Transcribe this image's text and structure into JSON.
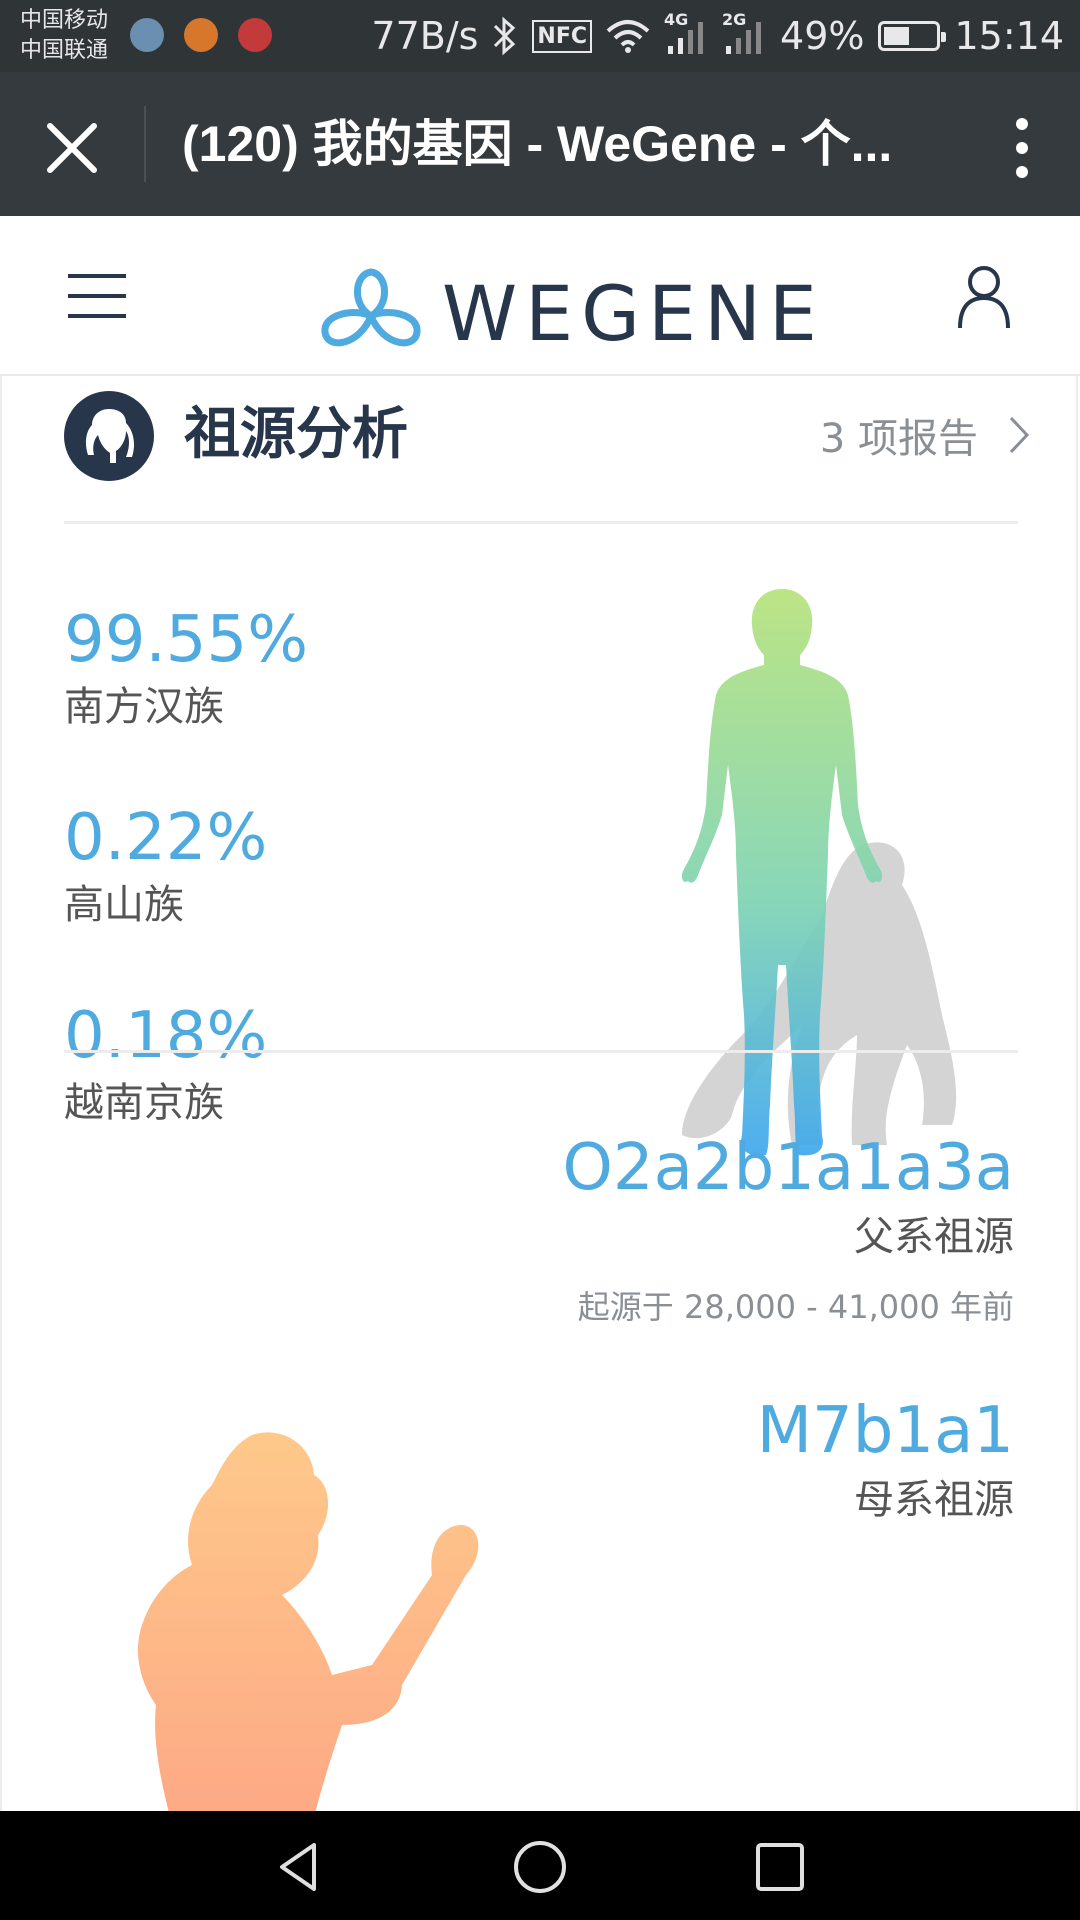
{
  "status_bar": {
    "carrier_1": "中国移动",
    "carrier_2": "中国联通",
    "net_speed": "77B/s",
    "nfc": "NFC",
    "net_4g": "4G",
    "net_2g": "2G",
    "battery": "49%",
    "battery_level": 0.49,
    "time": "15:14"
  },
  "title_bar": {
    "title": "(120) 我的基因 - WeGene - 个..."
  },
  "header": {
    "logo_text": "WEGENE"
  },
  "section": {
    "title": "祖源分析",
    "report_link": "3 项报告"
  },
  "ancestry": [
    {
      "percent": "99.55%",
      "name": "南方汉族"
    },
    {
      "percent": "0.22%",
      "name": "高山族"
    },
    {
      "percent": "0.18%",
      "name": "越南京族"
    }
  ],
  "haplogroups": {
    "paternal": {
      "code": "O2a2b1a1a3a",
      "label": "父系祖源",
      "age_prefix": "起源于",
      "age_range": "28,000 - 41,000",
      "age_suffix": "年前"
    },
    "maternal": {
      "code": "M7b1a1",
      "label": "母系祖源"
    }
  },
  "colors": {
    "accent": "#4eaadf",
    "brand_dark": "#27364a",
    "title_bar": "#353a3f",
    "figure_top": "#b6e27a",
    "figure_bottom": "#3fa7ee",
    "caveman": "#fdb07e"
  }
}
